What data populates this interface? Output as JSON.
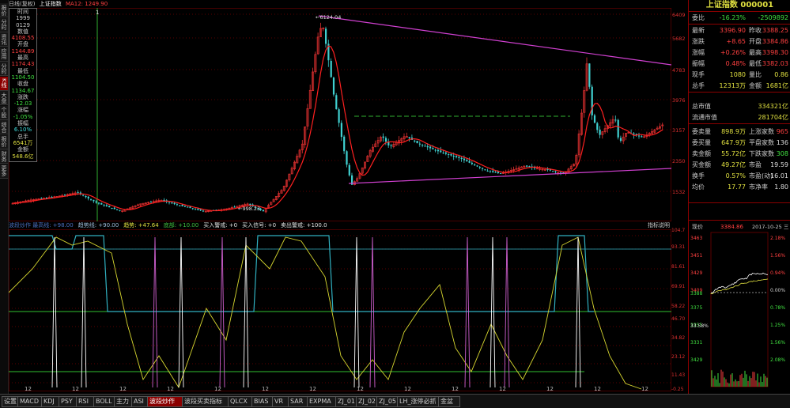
{
  "left_sidebar": {
    "items": [
      "报价",
      "分时",
      "资讯",
      "应用",
      "分时图",
      "K线图",
      "大盘资讯",
      "个股资讯",
      "综合排名",
      "报价分析",
      "财务",
      "更多"
    ]
  },
  "top": {
    "period": "日线(复权)",
    "index_name": "上证指数",
    "ma_label": "MA12: 1249.90",
    "window_buttons": "■ ▲ ✕"
  },
  "chart_marks": {
    "cursor_label": "1",
    "high_label": "6124.04",
    "low_label": "998.23"
  },
  "info_box": {
    "time_label": "时间",
    "date_year": "1999",
    "date_md": "0129",
    "value_label": "数值",
    "value": "4108.55",
    "open_label": "开盘",
    "open": "1144.89",
    "high_label": "最高",
    "high": "1174.43",
    "low_label": "最低",
    "low": "1104.50",
    "close_label": "收盘",
    "close": "1134.67",
    "change_label": "涨跌",
    "change": "-12.03",
    "pct_label": "涨幅",
    "pct": "-1.05%",
    "amp_label": "振幅",
    "amp": "6.10%",
    "vol_label": "总手",
    "vol": "6541万",
    "amount_label": "金额",
    "amount": "548.6亿"
  },
  "upper_axis": [
    "6409",
    "5682",
    "4783",
    "3976",
    "3157",
    "2350",
    "1532"
  ],
  "lower_axis": [
    "104.7",
    "93.31",
    "81.61",
    "69.91",
    "58.22",
    "46.70",
    "34.82",
    "23.12",
    "11.43",
    "-0.25"
  ],
  "indicator_strip": {
    "items": [
      {
        "text": "波段炒作 最高线: +98.00",
        "color": "#4a6fbf"
      },
      {
        "text": "趋势线: +90.00",
        "color": "#9dbbd9"
      },
      {
        "text": "趋势: +47.64",
        "color": "#e0e040"
      },
      {
        "text": "底部: +10.00",
        "color": "#40c040"
      },
      {
        "text": "买入警戒: +0",
        "color": "#e0e0e0"
      },
      {
        "text": "买入信号: +0",
        "color": "#e0e0e0"
      },
      {
        "text": "卖出警戒: +100.0",
        "color": "#e0e0e0"
      }
    ],
    "help": "指标说明"
  },
  "bottom_axis_label": "12",
  "tabs": [
    "设置",
    "MACD",
    "KDJ",
    "PSY",
    "RSI",
    "BOLL",
    "主力",
    "ASI",
    "波段炒作",
    "波段买卖指标",
    "QLCX",
    "BIAS",
    "VR",
    "SAR",
    "EXPMA",
    "ZJ_01",
    "ZJ_02",
    "ZJ_05",
    "LH_涨停必抓",
    "金盆"
  ],
  "active_tab": "波段炒作",
  "right_panel": {
    "title": "上证指数 000001",
    "rows": [
      {
        "l": "委比",
        "v1": "-16.23%",
        "l2": "",
        "v2": "-2509892"
      },
      {
        "l": "最新",
        "v1": "3396.90",
        "l2": "昨收",
        "v2": "3388.25"
      },
      {
        "l": "涨跌",
        "v1": "+8.65",
        "l2": "开盘",
        "v2": "3384.86"
      },
      {
        "l": "涨幅",
        "v1": "+0.26%",
        "l2": "最高",
        "v2": "3398.30"
      },
      {
        "l": "振幅",
        "v1": "0.48%",
        "l2": "最低",
        "v2": "3382.03"
      },
      {
        "l": "现手",
        "v1": "1080",
        "l2": "量比",
        "v2": "0.86"
      },
      {
        "l": "总手",
        "v1": "12313万",
        "l2": "金额",
        "v2": "1681亿"
      },
      {
        "l": "总市值",
        "v1": "",
        "l2": "",
        "v2": "334321亿"
      },
      {
        "l": "流通市值",
        "v1": "",
        "l2": "",
        "v2": "281704亿"
      },
      {
        "l": "委卖量",
        "v1": "898.9万",
        "l2": "上涨家数",
        "v2": "965"
      },
      {
        "l": "委买量",
        "v1": "647.9万",
        "l2": "平盘家数",
        "v2": "136"
      },
      {
        "l": "卖金额",
        "v1": "55.72亿",
        "l2": "下跌家数",
        "v2": "308"
      },
      {
        "l": "买金额",
        "v1": "49.27亿",
        "l2": "市盈",
        "v2": "19.59"
      },
      {
        "l": "换手",
        "v1": "0.57%",
        "l2": "市盈(动)",
        "v2": "16.01"
      },
      {
        "l": "均价",
        "v1": "17.77",
        "l2": "市净率",
        "v2": "1.80"
      }
    ],
    "mini_label": "现价",
    "mini_price": "3384.86",
    "mini_date": "2017-10-25 三",
    "mini_left_axis": [
      "3463",
      "3451",
      "3429",
      "3409",
      "3388",
      "3375",
      "3355",
      "3331",
      "3429"
    ],
    "mini_right_axis": [
      "2.18%",
      "1.56%",
      "0.94%",
      "0.00%",
      "0.78%",
      "1.25%",
      "1.56%",
      "2.08%"
    ],
    "mini_pct": "33.58%"
  },
  "colors": {
    "up": "#e03030",
    "down": "#40d0d0",
    "ma": "#ff2020",
    "trend_line": "#d040d0",
    "yellow": "#d8d830"
  }
}
